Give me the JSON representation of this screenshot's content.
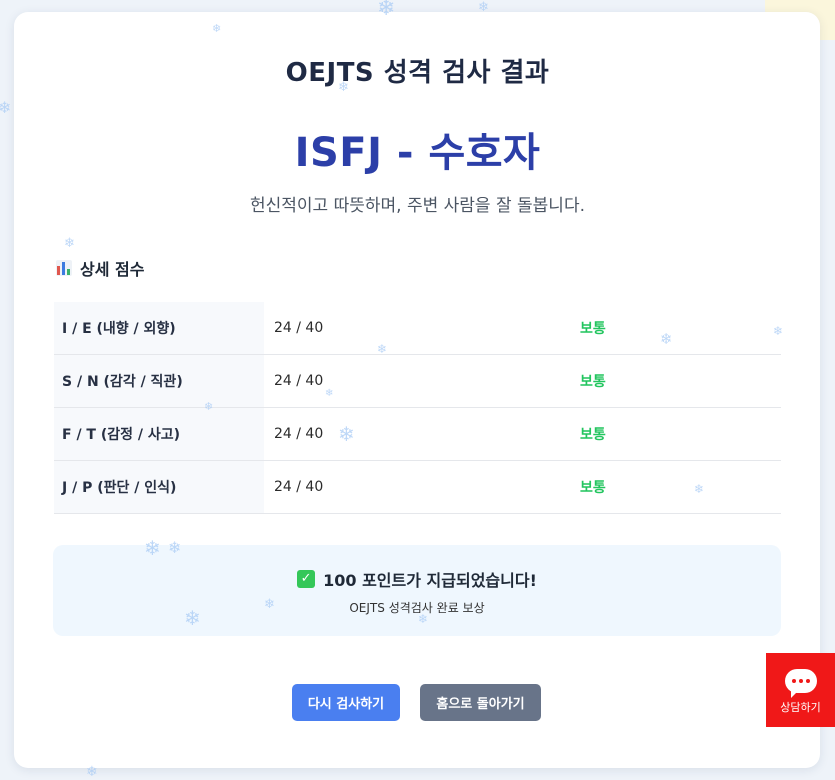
{
  "header": {
    "title": "OEJTS 성격 검사 결과",
    "type_name": "ISFJ - 수호자",
    "type_description": "헌신적이고 따뜻하며, 주변 사람을 잘 돌봅니다."
  },
  "details": {
    "section_title": "상세 점수",
    "rows": [
      {
        "dimension": "I / E (내향 / 외향)",
        "score": "24 / 40",
        "level": "보통"
      },
      {
        "dimension": "S / N (감각 / 직관)",
        "score": "24 / 40",
        "level": "보통"
      },
      {
        "dimension": "F / T (감정 / 사고)",
        "score": "24 / 40",
        "level": "보통"
      },
      {
        "dimension": "J / P (판단 / 인식)",
        "score": "24 / 40",
        "level": "보통"
      }
    ]
  },
  "reward": {
    "title": "100 포인트가 지급되었습니다!",
    "subtitle": "OEJTS 성격검사 완료 보상"
  },
  "buttons": {
    "retry_label": "다시 검사하기",
    "home_label": "홈으로 돌아가기"
  },
  "chat_widget": {
    "label": "상담하기"
  },
  "colors": {
    "type_name": "#2c3fa8",
    "level_text": "#22c55e",
    "retry_button": "#4a7ff0",
    "home_button": "#687489",
    "chat_widget": "#f01818",
    "reward_bg": "#eff7fe"
  },
  "icons": {
    "section": "bar-chart-icon",
    "reward": "check-mark-icon",
    "chat": "chat-bubble-icon",
    "decor": "snowflake-icon"
  }
}
